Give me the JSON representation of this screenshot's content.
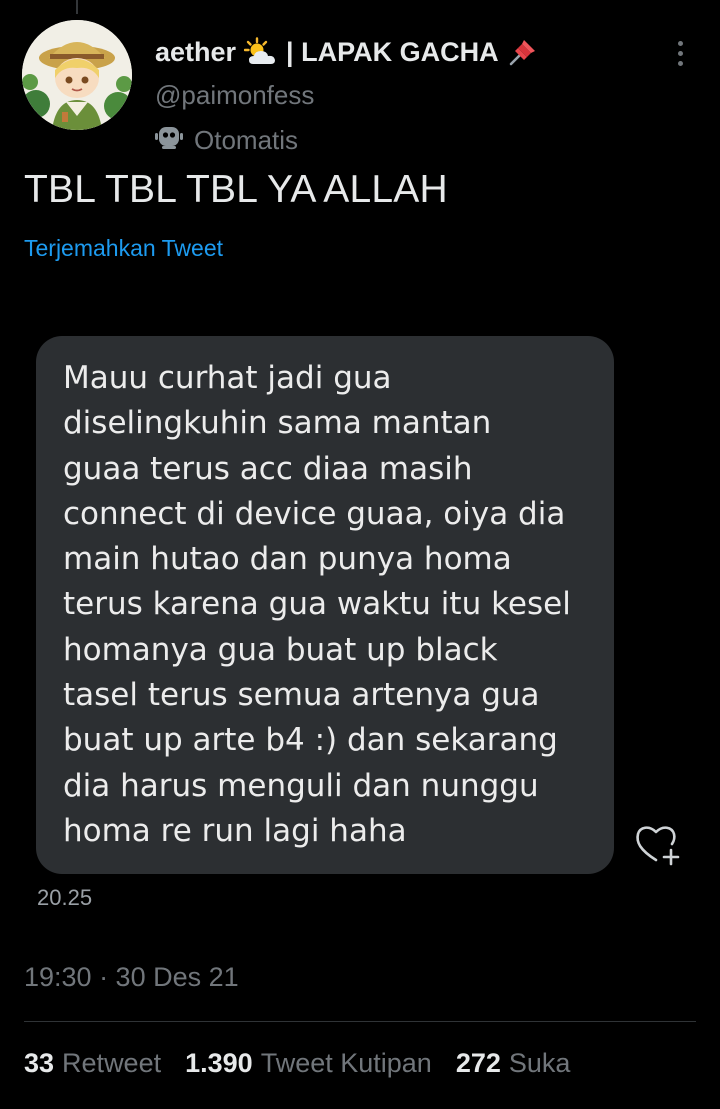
{
  "tweet": {
    "display_name": "aether",
    "display_name_suffix": "| LAPAK GACHA",
    "handle": "@paimonfess",
    "automated_label": "Otomatis",
    "text": "TBL TBL TBL YA ALLAH",
    "translate_link": "Terjemahkan Tweet",
    "timestamp": "19:30 · 30 Des 21",
    "icons": {
      "name_emoji_1": "sun-behind-cloud-icon",
      "name_emoji_2": "pushpin-icon",
      "automated": "robot-icon",
      "more": "more-options-icon",
      "avatar": "avatar"
    },
    "colors": {
      "background": "#000000",
      "primary_text": "#e7e9ea",
      "secondary_text": "#71767b",
      "link": "#1d9bf0",
      "bubble": "#2c2f32"
    }
  },
  "media": {
    "message_lines": [
      "Mauu curhat jadi gua",
      "diselingkuhin sama mantan",
      "guaa terus acc diaa masih",
      "connect di device guaa, oiya dia",
      "main hutao dan punya homa",
      "terus karena gua waktu itu kesel",
      "homanya gua buat up black",
      "tasel terus semua artenya gua",
      "buat up arte b4 :) dan sekarang",
      "dia harus menguli dan nunggu",
      "homa re run lagi haha"
    ],
    "message_time": "20.25",
    "reaction_icon": "heart-plus-icon"
  },
  "stats": {
    "retweets_count": "33",
    "retweets_label": "Retweet",
    "quotes_count": "1.390",
    "quotes_label": "Tweet Kutipan",
    "likes_count": "272",
    "likes_label": "Suka"
  }
}
